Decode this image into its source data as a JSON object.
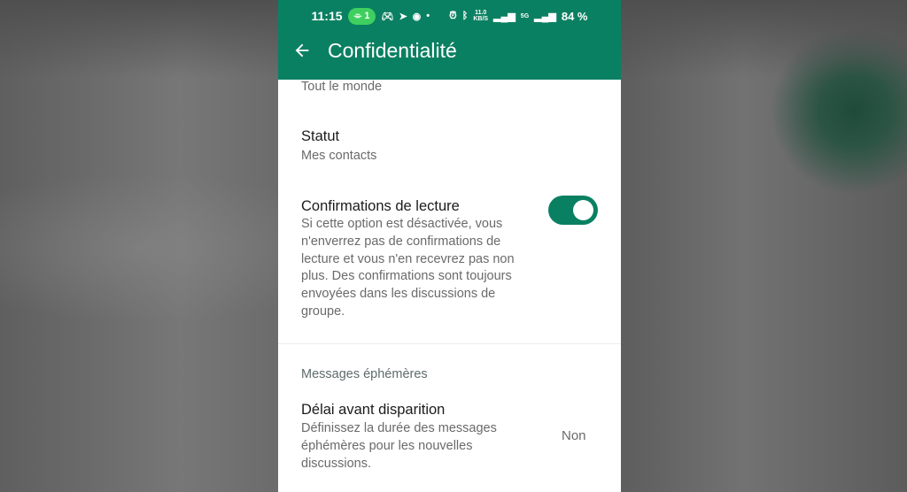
{
  "status_bar": {
    "time": "11:15",
    "hotspot_count": "1",
    "net_speed": "11.0",
    "net_speed_unit": "KB/S",
    "signal_label": "5G",
    "battery": "84 %"
  },
  "header": {
    "title": "Confidentialité",
    "back_icon": "arrow-left-icon"
  },
  "items": [
    {
      "secondary": "Tout le monde"
    },
    {
      "primary": "Statut",
      "secondary": "Mes contacts"
    },
    {
      "primary": "Confirmations de lecture",
      "secondary_lines": [
        "Si cette option est désactivée, vous",
        "n'enverrez pas de confirmations de",
        "lecture et vous n'en recevrez pas non",
        "plus. Des confirmations sont toujours",
        "envoyées dans les discussions de",
        "groupe."
      ],
      "toggle_on": true
    }
  ],
  "section_title": "Messages éphémères",
  "disappearing": {
    "primary": "Délai avant disparition",
    "secondary_lines": [
      "Définissez la durée des messages",
      "éphémères pour les nouvelles",
      "discussions."
    ],
    "value": "Non"
  },
  "colors": {
    "accent": "#0a8062",
    "hotspot": "#3fcf5f"
  }
}
